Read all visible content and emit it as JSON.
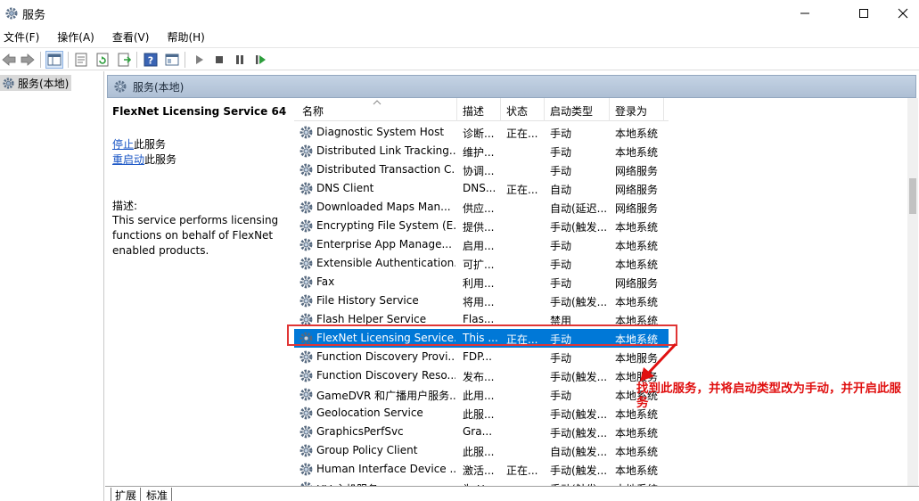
{
  "window": {
    "title": "服务",
    "icons": {
      "app": "gear-icon",
      "minimize": "minimize-icon",
      "maximize": "maximize-icon",
      "close": "close-icon"
    }
  },
  "menu": [
    "文件(F)",
    "操作(A)",
    "查看(V)",
    "帮助(H)"
  ],
  "toolbar": [
    "back-arrow-icon",
    "forward-arrow-icon",
    "console-tree-icon",
    "properties-icon",
    "refresh-icon",
    "export-icon",
    "help-icon",
    "mmc-view-icon",
    "start-service-icon",
    "stop-service-icon",
    "pause-service-icon",
    "restart-service-icon"
  ],
  "tree": {
    "label": "服务(本地)"
  },
  "pane_header": "服务(本地)",
  "detail": {
    "service_name": "FlexNet Licensing Service 64",
    "stop_link": "停止",
    "stop_suffix": "此服务",
    "restart_link": "重启动",
    "restart_suffix": "此服务",
    "desc_label": "描述:",
    "desc_lines": [
      "This service performs licensing",
      "functions on behalf of FlexNet",
      "enabled products."
    ]
  },
  "columns": {
    "name": "名称",
    "desc": "描述",
    "status": "状态",
    "startup": "启动类型",
    "logon": "登录为"
  },
  "rows": [
    {
      "name": "Diagnostic System Host",
      "desc": "诊断...",
      "status": "正在...",
      "startup": "手动",
      "logon": "本地系统"
    },
    {
      "name": "Distributed Link Tracking...",
      "desc": "维护...",
      "status": "",
      "startup": "手动",
      "logon": "本地系统"
    },
    {
      "name": "Distributed Transaction C...",
      "desc": "协调...",
      "status": "",
      "startup": "手动",
      "logon": "网络服务"
    },
    {
      "name": "DNS Client",
      "desc": "DNS...",
      "status": "正在...",
      "startup": "自动",
      "logon": "网络服务"
    },
    {
      "name": "Downloaded Maps Man...",
      "desc": "供应...",
      "status": "",
      "startup": "自动(延迟...",
      "logon": "网络服务"
    },
    {
      "name": "Encrypting File System (E...",
      "desc": "提供...",
      "status": "",
      "startup": "手动(触发...",
      "logon": "本地系统"
    },
    {
      "name": "Enterprise App Manage...",
      "desc": "启用...",
      "status": "",
      "startup": "手动",
      "logon": "本地系统"
    },
    {
      "name": "Extensible Authentication...",
      "desc": "可扩...",
      "status": "",
      "startup": "手动",
      "logon": "本地系统"
    },
    {
      "name": "Fax",
      "desc": "利用...",
      "status": "",
      "startup": "手动",
      "logon": "网络服务"
    },
    {
      "name": "File History Service",
      "desc": "将用...",
      "status": "",
      "startup": "手动(触发...",
      "logon": "本地系统"
    },
    {
      "name": "Flash Helper Service",
      "desc": "Flas...",
      "status": "",
      "startup": "禁用",
      "logon": "本地系统"
    },
    {
      "name": "FlexNet Licensing Service...",
      "desc": "This ...",
      "status": "正在...",
      "startup": "手动",
      "logon": "本地系统",
      "selected": true
    },
    {
      "name": "Function Discovery Provi...",
      "desc": "FDP...",
      "status": "",
      "startup": "手动",
      "logon": "本地服务"
    },
    {
      "name": "Function Discovery Reso...",
      "desc": "发布...",
      "status": "",
      "startup": "手动(触发...",
      "logon": "本地服务"
    },
    {
      "name": "GameDVR 和广播用户服务...",
      "desc": "此用...",
      "status": "",
      "startup": "手动",
      "logon": "本地系统"
    },
    {
      "name": "Geolocation Service",
      "desc": "此服...",
      "status": "",
      "startup": "手动(触发...",
      "logon": "本地系统"
    },
    {
      "name": "GraphicsPerfSvc",
      "desc": "Gra...",
      "status": "",
      "startup": "手动(触发...",
      "logon": "本地系统"
    },
    {
      "name": "Group Policy Client",
      "desc": "此服...",
      "status": "",
      "startup": "自动(触发...",
      "logon": "本地系统"
    },
    {
      "name": "Human Interface Device ...",
      "desc": "激活...",
      "status": "正在...",
      "startup": "手动(触发...",
      "logon": "本地系统"
    },
    {
      "name": "HV 主机服务",
      "desc": "为 H...",
      "status": "",
      "startup": "手动(触发...",
      "logon": "本地系统"
    }
  ],
  "annotation": "找到此服务，并将启动类型改为手动，并开启此服务",
  "tabs": [
    "扩展",
    "标准"
  ],
  "colors": {
    "selection": "#0078d7",
    "highlight_box": "#e03535",
    "annotation": "#e01010",
    "link": "#1a56c5"
  }
}
